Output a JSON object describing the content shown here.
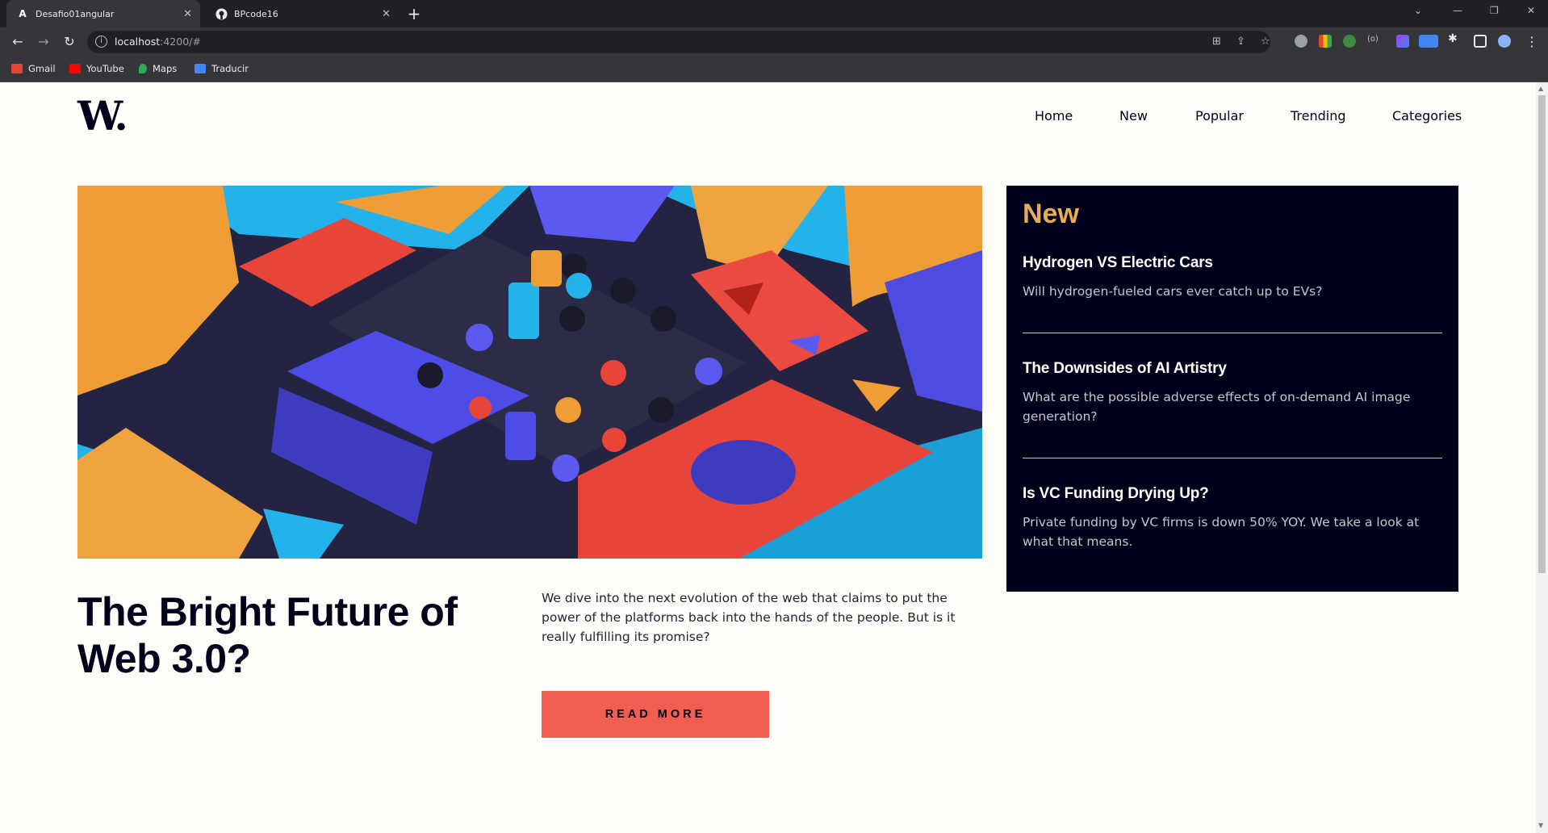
{
  "browser": {
    "tabs": [
      {
        "title": "Desafio01angular",
        "icon": "angular-icon"
      },
      {
        "title": "BPcode16",
        "icon": "github-icon"
      }
    ],
    "url_host": "localhost",
    "url_path": ":4200/#",
    "bookmarks": [
      {
        "label": "Gmail",
        "color": "#ea4335"
      },
      {
        "label": "YouTube",
        "color": "#ff0000"
      },
      {
        "label": "Maps",
        "color": "#34a853"
      },
      {
        "label": "Traducir",
        "color": "#4285f4"
      }
    ]
  },
  "site": {
    "logo": "W.",
    "nav": [
      "Home",
      "New",
      "Popular",
      "Trending",
      "Categories"
    ]
  },
  "article": {
    "title": "The Bright Future of Web 3.0?",
    "lede": "We dive into the next evolution of the web that claims to put the power of the platforms back into the hands of the people. But is it really fulfilling its promise?",
    "cta": "READ MORE"
  },
  "sidebar": {
    "heading": "New",
    "items": [
      {
        "title": "Hydrogen VS Electric Cars",
        "text": "Will hydrogen-fueled cars ever catch up to EVs?"
      },
      {
        "title": "The Downsides of AI Artistry",
        "text": "What are the possible adverse effects of on-demand AI image generation?"
      },
      {
        "title": "Is VC Funding Drying Up?",
        "text": "Private funding by VC firms is down 50% YOY. We take a look at what that means."
      }
    ]
  },
  "colors": {
    "accent_red": "#f15e50",
    "accent_orange": "#e9ab53",
    "dark_navy": "#00001a",
    "off_white": "#fffdf9"
  }
}
